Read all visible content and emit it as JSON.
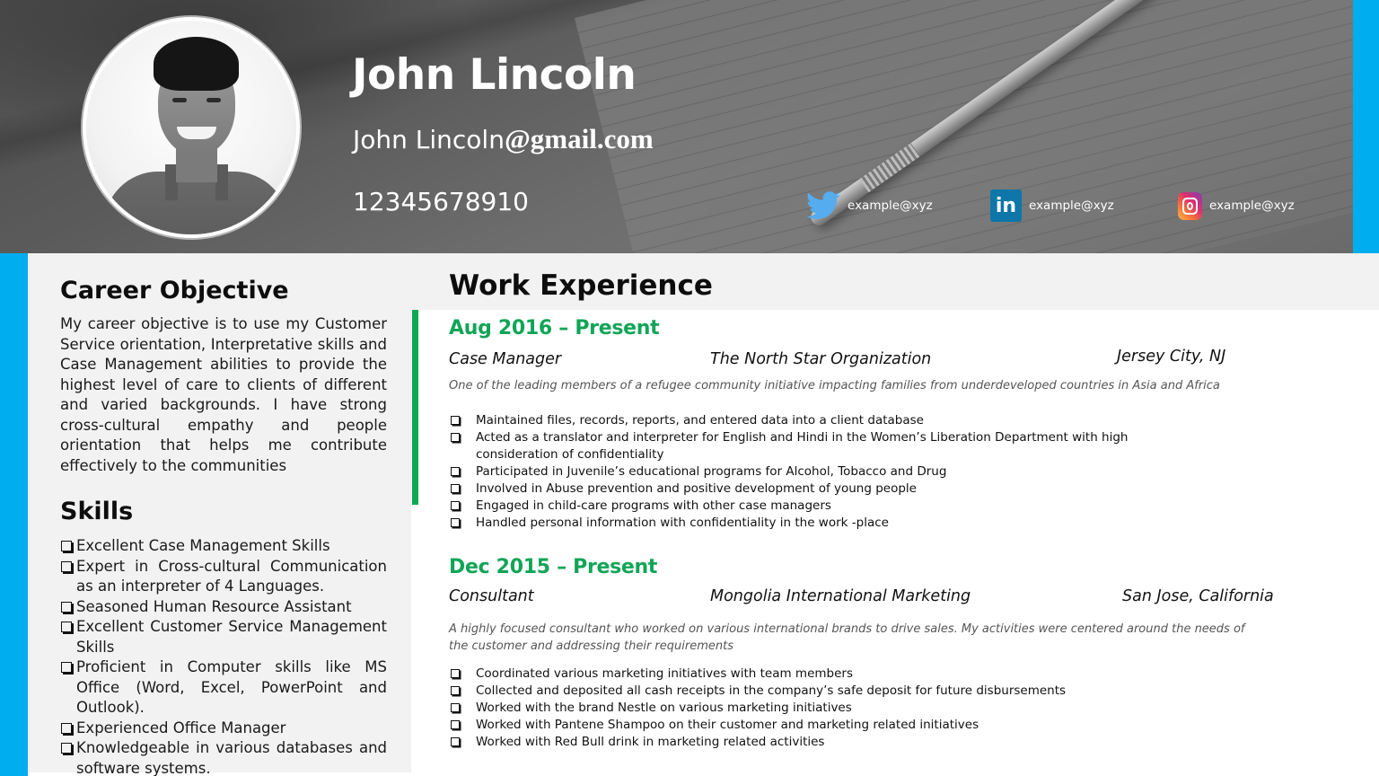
{
  "header": {
    "name": "John Lincoln",
    "email_user": "John Lincoln",
    "email_domain": "@gmail.com",
    "phone": "12345678910",
    "social": [
      {
        "network": "twitter",
        "icon": "twitter-bird-icon",
        "handle": "example@xyz",
        "color": "#55acee"
      },
      {
        "network": "linkedin",
        "icon": "linkedin-icon",
        "icon_text": "in",
        "handle": "example@xyz",
        "color": "#0e76a8"
      },
      {
        "network": "instagram",
        "icon": "instagram-icon",
        "handle": "example@xyz",
        "color": "#e1306c"
      }
    ]
  },
  "colors": {
    "accent_blue": "#00adef",
    "accent_green": "#11a557",
    "panel_gray": "#f2f2f2"
  },
  "career_objective": {
    "title": "Career Objective",
    "text": "My career objective is to use my Customer Service orientation, Interpretative skills and Case Management abilities to provide the highest level of care to clients of different and varied backgrounds. I have strong cross-cultural empathy and people orientation that helps me contribute effectively to the communities"
  },
  "skills": {
    "title": "Skills",
    "items": [
      "Excellent Case Management Skills",
      "Expert in Cross-cultural Communication as an interpreter of 4 Languages.",
      "Seasoned Human Resource Assistant",
      "Excellent Customer Service Management Skills",
      "Proficient in Computer skills like MS Office (Word, Excel, PowerPoint and Outlook).",
      "Experienced Office Manager",
      "Knowledgeable in various databases and software systems."
    ]
  },
  "work_experience": {
    "title": "Work Experience",
    "jobs": [
      {
        "date": "Aug 2016 – Present",
        "role": "Case Manager",
        "organization": "The North Star Organization",
        "location": "Jersey City, NJ",
        "description": "One of the leading members of  a refugee community initiative impacting families from underdeveloped countries in Asia and Africa",
        "bullets": [
          "Maintained files, records, reports, and entered data into a client database",
          "Acted as a translator and interpreter for English and Hindi  in the Women’s Liberation Department with high consideration of confidentiality",
          "Participated in Juvenile’s educational programs for Alcohol, Tobacco and Drug",
          "Involved in Abuse prevention and positive development of young people",
          "Engaged in child-care programs with other case managers",
          "Handled personal information with confidentiality in the work -place"
        ]
      },
      {
        "date": "Dec 2015 – Present",
        "role": "Consultant",
        "organization": "Mongolia International Marketing",
        "location": "San Jose, California",
        "description": "A highly focused consultant who worked on various international brands to drive sales. My activities were centered around the needs of the customer and addressing their requirements",
        "bullets": [
          "Coordinated various marketing  initiatives with team members",
          "Collected and deposited all cash receipts in the company’s safe deposit for future disbursements",
          "Worked with the brand Nestle on various marketing initiatives",
          "Worked with Pantene Shampoo on their customer and marketing related initiatives",
          "Worked with Red Bull drink in marketing related activities"
        ]
      }
    ]
  }
}
